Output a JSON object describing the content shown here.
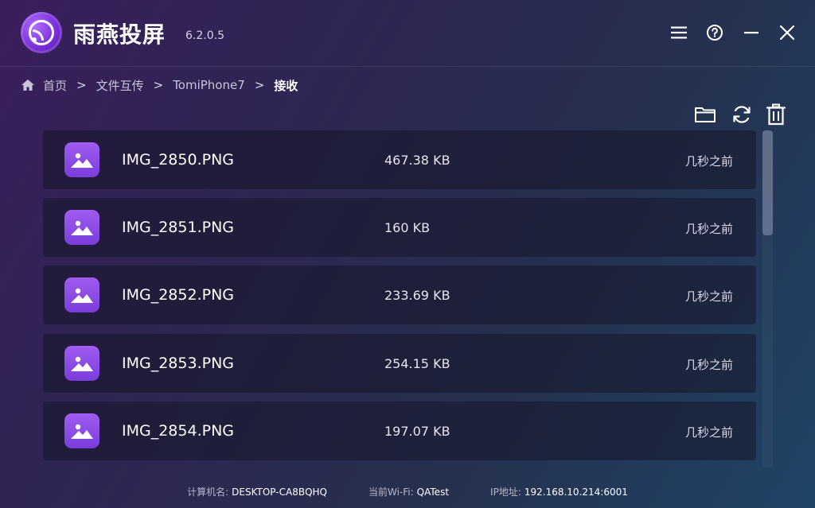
{
  "app": {
    "title": "雨燕投屏",
    "version": "6.2.0.5"
  },
  "window_controls": {
    "menu_icon": "hamburger-menu-icon",
    "help_icon": "help-circle-icon",
    "minimize_icon": "minimize-icon",
    "close_icon": "close-icon"
  },
  "breadcrumb": {
    "home_icon": "home-icon",
    "items": [
      "首页",
      "文件互传",
      "TomiPhone7",
      "接收"
    ],
    "separator": ">"
  },
  "toolbar": {
    "folder_icon": "folder-icon",
    "refresh_icon": "refresh-icon",
    "delete_icon": "trash-icon"
  },
  "files": [
    {
      "name": "IMG_2850.PNG",
      "size": "467.38 KB",
      "time": "几秒之前",
      "icon": "image-icon"
    },
    {
      "name": "IMG_2851.PNG",
      "size": "160 KB",
      "time": "几秒之前",
      "icon": "image-icon"
    },
    {
      "name": "IMG_2852.PNG",
      "size": "233.69 KB",
      "time": "几秒之前",
      "icon": "image-icon"
    },
    {
      "name": "IMG_2853.PNG",
      "size": "254.15 KB",
      "time": "几秒之前",
      "icon": "image-icon"
    },
    {
      "name": "IMG_2854.PNG",
      "size": "197.07 KB",
      "time": "几秒之前",
      "icon": "image-icon"
    }
  ],
  "status": {
    "computer_label": "计算机名:",
    "computer_value": "DESKTOP-CA8BQHQ",
    "wifi_label": "当前Wi-Fi:",
    "wifi_value": "QATest",
    "ip_label": "IP地址:",
    "ip_value": "192.168.10.214:6001"
  },
  "colors": {
    "accent": "#8a4be6",
    "row_background": "#1a1a2e"
  }
}
